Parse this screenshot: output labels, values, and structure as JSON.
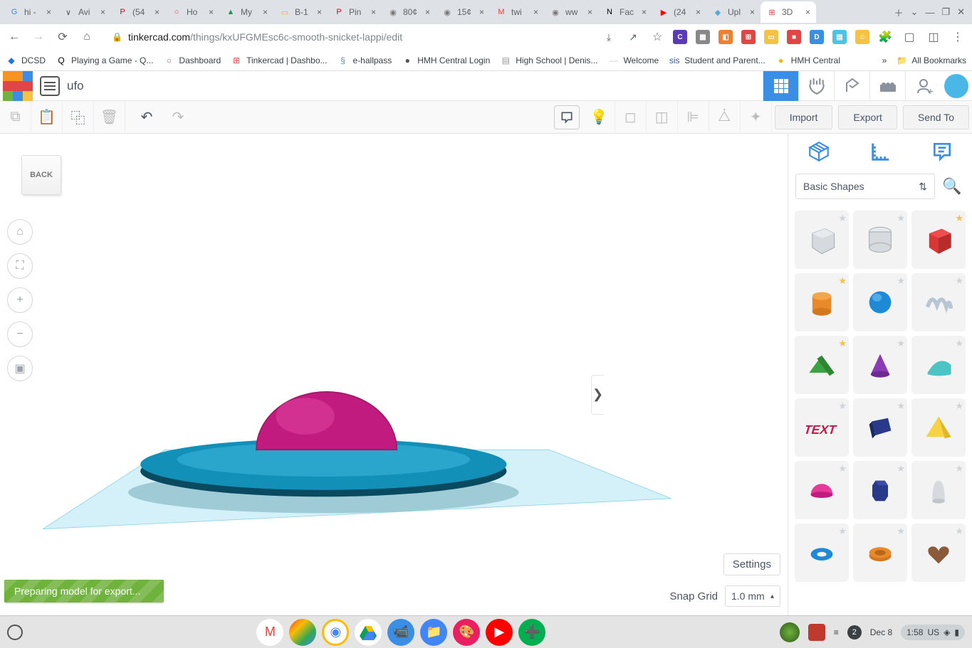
{
  "browser": {
    "tabs": [
      {
        "title": "hi -",
        "favicon": "G",
        "color": "#4285f4"
      },
      {
        "title": "Avi",
        "favicon": "∨",
        "color": "#555"
      },
      {
        "title": "(54",
        "favicon": "P",
        "color": "#e60023"
      },
      {
        "title": "Ho",
        "favicon": "○",
        "color": "#e04646"
      },
      {
        "title": "My",
        "favicon": "▲",
        "color": "#0f9d58"
      },
      {
        "title": "B-1",
        "favicon": "▭",
        "color": "#f4b400"
      },
      {
        "title": "Pin",
        "favicon": "P",
        "color": "#e60023"
      },
      {
        "title": "80¢",
        "favicon": "◉",
        "color": "#777"
      },
      {
        "title": "15¢",
        "favicon": "◉",
        "color": "#777"
      },
      {
        "title": "twi",
        "favicon": "M",
        "color": "#ea4335"
      },
      {
        "title": "ww",
        "favicon": "◉",
        "color": "#777"
      },
      {
        "title": "Fac",
        "favicon": "N",
        "color": "#000"
      },
      {
        "title": "(24",
        "favicon": "▶",
        "color": "#ff0000"
      },
      {
        "title": "Upl",
        "favicon": "◆",
        "color": "#5aa8d8"
      },
      {
        "title": "3D",
        "favicon": "⊞",
        "color": "#e04646",
        "active": true
      }
    ],
    "url_domain": "tinkercad.com",
    "url_path": "/things/kxUFGMEsc6c-smooth-snicket-lappi/edit",
    "bookmarks": [
      {
        "label": "DCSD",
        "icon": "◆",
        "color": "#1a73e8"
      },
      {
        "label": "Playing a Game - Q...",
        "icon": "Q",
        "color": "#000"
      },
      {
        "label": "Dashboard",
        "icon": "○",
        "color": "#e04646"
      },
      {
        "label": "Tinkercad | Dashbo...",
        "icon": "⊞",
        "color": "#e04646"
      },
      {
        "label": "e-hallpass",
        "icon": "§",
        "color": "#3a8ee6"
      },
      {
        "label": "HMH Central Login",
        "icon": "●",
        "color": "#555"
      },
      {
        "label": "High School | Denis...",
        "icon": "▤",
        "color": "#999"
      },
      {
        "label": "Welcome",
        "icon": "—",
        "color": "#ccc"
      },
      {
        "label": "Student and Parent...",
        "icon": "sis",
        "color": "#2a5caa"
      },
      {
        "label": "HMH Central",
        "icon": "●",
        "color": "#f4b400"
      }
    ],
    "all_bookmarks": "All Bookmarks"
  },
  "app": {
    "title": "ufo",
    "toolbar": {
      "import": "Import",
      "export": "Export",
      "send_to": "Send To"
    },
    "back_chip": "BACK",
    "settings": "Settings",
    "snap_label": "Snap Grid",
    "snap_value": "1.0 mm",
    "export_toast": "Preparing model for export...",
    "panel": {
      "category": "Basic Shapes",
      "shapes": [
        {
          "name": "box-hole",
          "star": "gray"
        },
        {
          "name": "cylinder-hole",
          "star": "gray"
        },
        {
          "name": "box",
          "star": "gold"
        },
        {
          "name": "cylinder",
          "star": "gold"
        },
        {
          "name": "sphere",
          "star": "gray"
        },
        {
          "name": "scribble",
          "star": "gray"
        },
        {
          "name": "roof",
          "star": "gold"
        },
        {
          "name": "cone",
          "star": "gray"
        },
        {
          "name": "wedge",
          "star": "gray"
        },
        {
          "name": "text",
          "star": "gray"
        },
        {
          "name": "polygon",
          "star": "gray"
        },
        {
          "name": "pyramid",
          "star": "gray"
        },
        {
          "name": "half-sphere",
          "star": "gray"
        },
        {
          "name": "hexagon-prism",
          "star": "gray"
        },
        {
          "name": "paraboloid",
          "star": "gray"
        },
        {
          "name": "torus",
          "star": "gray"
        },
        {
          "name": "tube",
          "star": "gray"
        },
        {
          "name": "heart",
          "star": "gray"
        }
      ]
    }
  },
  "shelf": {
    "date": "Dec 8",
    "time": "1:58",
    "locale": "US",
    "notifications": "2"
  }
}
